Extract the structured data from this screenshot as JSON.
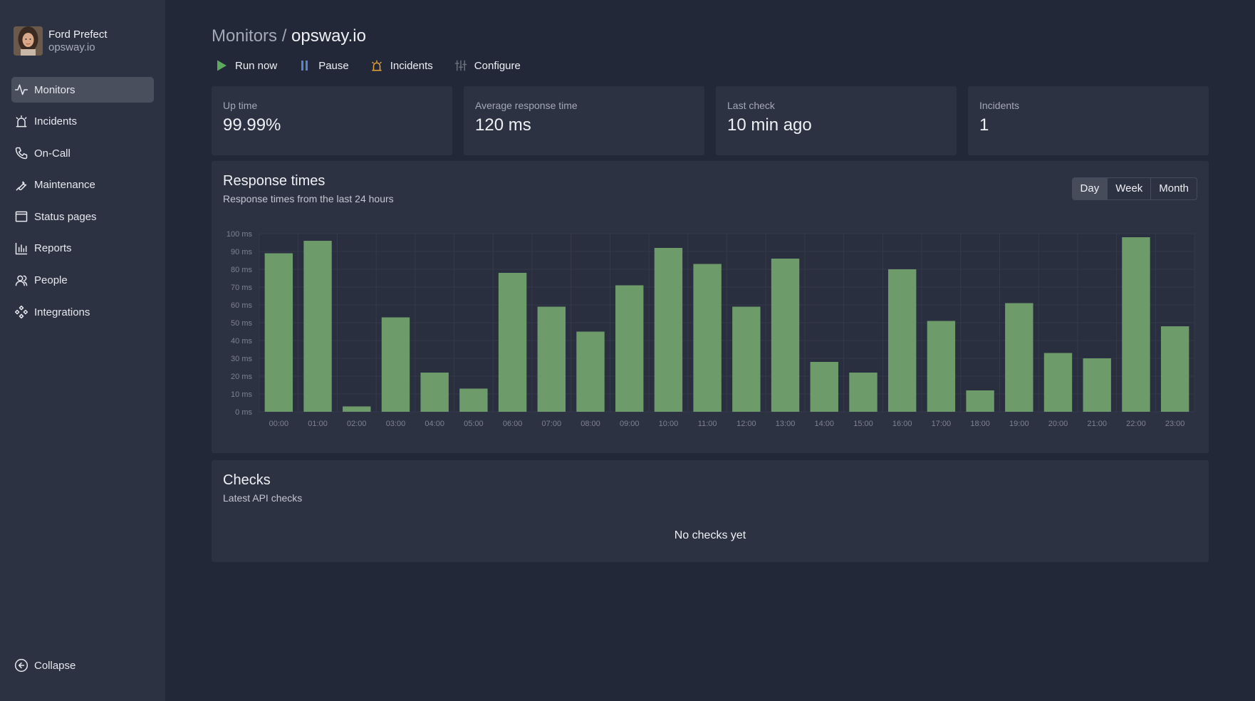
{
  "user": {
    "name": "Ford Prefect",
    "org": "opsway.io"
  },
  "nav": {
    "items": [
      {
        "label": "Monitors",
        "icon": "activity-icon",
        "active": true
      },
      {
        "label": "Incidents",
        "icon": "alarm-icon"
      },
      {
        "label": "On-Call",
        "icon": "phone-icon"
      },
      {
        "label": "Maintenance",
        "icon": "wrench-icon"
      },
      {
        "label": "Status pages",
        "icon": "browser-icon"
      },
      {
        "label": "Reports",
        "icon": "bar-chart-icon"
      },
      {
        "label": "People",
        "icon": "users-icon"
      },
      {
        "label": "Integrations",
        "icon": "integrations-icon"
      }
    ],
    "collapse_label": "Collapse"
  },
  "breadcrumb": {
    "parent": "Monitors",
    "separator": "/",
    "current": "opsway.io"
  },
  "toolbar": {
    "run_label": "Run now",
    "pause_label": "Pause",
    "incidents_label": "Incidents",
    "configure_label": "Configure"
  },
  "colors": {
    "run": "#5fa85f",
    "pause": "#5a86c8",
    "incidents": "#e6a33a",
    "bar": "#6e9b6a"
  },
  "stats": [
    {
      "label": "Up time",
      "value": "99.99%"
    },
    {
      "label": "Average response time",
      "value": "120 ms"
    },
    {
      "label": "Last check",
      "value": "10 min ago"
    },
    {
      "label": "Incidents",
      "value": "1"
    }
  ],
  "response_card": {
    "title": "Response times",
    "subtitle": "Response times from the last 24 hours",
    "ranges": [
      "Day",
      "Week",
      "Month"
    ],
    "selected_range": "Day"
  },
  "chart_data": {
    "type": "bar",
    "categories": [
      "00:00",
      "01:00",
      "02:00",
      "03:00",
      "04:00",
      "05:00",
      "06:00",
      "07:00",
      "08:00",
      "09:00",
      "10:00",
      "11:00",
      "12:00",
      "13:00",
      "14:00",
      "15:00",
      "16:00",
      "17:00",
      "18:00",
      "19:00",
      "20:00",
      "21:00",
      "22:00",
      "23:00"
    ],
    "values": [
      89,
      96,
      3,
      53,
      22,
      13,
      78,
      59,
      45,
      71,
      92,
      83,
      59,
      86,
      28,
      22,
      80,
      51,
      12,
      61,
      33,
      30,
      98,
      48
    ],
    "y_ticks": [
      "0 ms",
      "10 ms",
      "20 ms",
      "30 ms",
      "40 ms",
      "50 ms",
      "60 ms",
      "70 ms",
      "80 ms",
      "90 ms",
      "100 ms"
    ],
    "ylim": [
      0,
      100
    ],
    "grid": true
  },
  "checks_card": {
    "title": "Checks",
    "subtitle": "Latest API checks",
    "empty_text": "No checks yet"
  }
}
